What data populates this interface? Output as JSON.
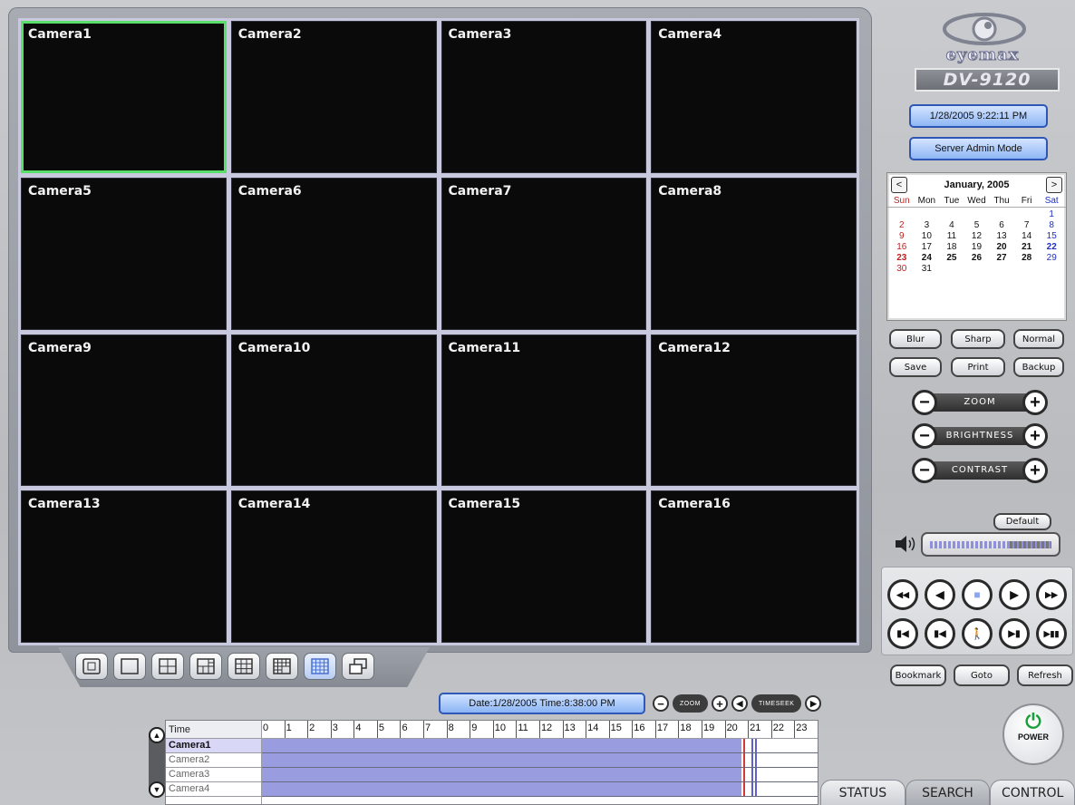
{
  "cameras": [
    "Camera1",
    "Camera2",
    "Camera3",
    "Camera4",
    "Camera5",
    "Camera6",
    "Camera7",
    "Camera8",
    "Camera9",
    "Camera10",
    "Camera11",
    "Camera12",
    "Camera13",
    "Camera14",
    "Camera15",
    "Camera16"
  ],
  "selected_camera": "Camera1",
  "layout_buttons": [
    "fullscreen-icon",
    "layout-1-icon",
    "layout-4-icon",
    "layout-6-icon",
    "layout-9-icon",
    "layout-10-icon",
    "layout-16-icon",
    "multi-window-icon"
  ],
  "active_layout": "layout-16-icon",
  "brand": {
    "name": "eyemax",
    "model": "DV-9120"
  },
  "status": {
    "datetime": "1/28/2005 9:22:11 PM",
    "mode": "Server Admin Mode"
  },
  "calendar": {
    "title": "January, 2005",
    "prev": "<",
    "next": ">",
    "dow": [
      "Sun",
      "Mon",
      "Tue",
      "Wed",
      "Thu",
      "Fri",
      "Sat"
    ],
    "leading_blanks": 6,
    "days": [
      "1",
      "2",
      "3",
      "4",
      "5",
      "6",
      "7",
      "8",
      "9",
      "10",
      "11",
      "12",
      "13",
      "14",
      "15",
      "16",
      "17",
      "18",
      "19",
      "20",
      "21",
      "22",
      "23",
      "24",
      "25",
      "26",
      "27",
      "28",
      "29",
      "30",
      "31"
    ],
    "bold_days": [
      "20",
      "21",
      "22",
      "23",
      "24",
      "25",
      "26",
      "27",
      "28"
    ]
  },
  "image_buttons": {
    "blur": "Blur",
    "sharp": "Sharp",
    "normal": "Normal",
    "save": "Save",
    "print": "Print",
    "backup": "Backup"
  },
  "adjust": {
    "zoom": "ZOOM",
    "brightness": "BRIGHTNESS",
    "contrast": "CONTRAST",
    "minus": "−",
    "plus": "+"
  },
  "default_label": "Default",
  "volume_level": 0.66,
  "player": {
    "row1": [
      "rewind-icon",
      "step-back-icon",
      "stop-icon",
      "play-icon",
      "fast-forward-icon"
    ],
    "row2": [
      "first-frame-icon",
      "prev-frame-icon",
      "motion-icon",
      "next-frame-icon",
      "play-pause-icon"
    ]
  },
  "nav": {
    "bookmark": "Bookmark",
    "goto": "Goto",
    "refresh": "Refresh"
  },
  "power_label": "POWER",
  "timeline": {
    "date_label": "Date:1/28/2005 Time:8:38:00 PM",
    "zoom_label": "ZOOM",
    "seek_label_1": "TIME",
    "seek_label_2": "SEEK",
    "header": "Time",
    "rows": [
      "Camera1",
      "Camera2",
      "Camera3",
      "Camera4"
    ],
    "hours": [
      "0",
      "1",
      "2",
      "3",
      "4",
      "5",
      "6",
      "7",
      "8",
      "9",
      "10",
      "11",
      "12",
      "13",
      "14",
      "15",
      "16",
      "17",
      "18",
      "19",
      "20",
      "21",
      "22",
      "23"
    ],
    "recorded_until_hour": 20.7
  },
  "tabs": [
    "STATUS",
    "SEARCH",
    "CONTROL"
  ],
  "active_tab": "SEARCH"
}
